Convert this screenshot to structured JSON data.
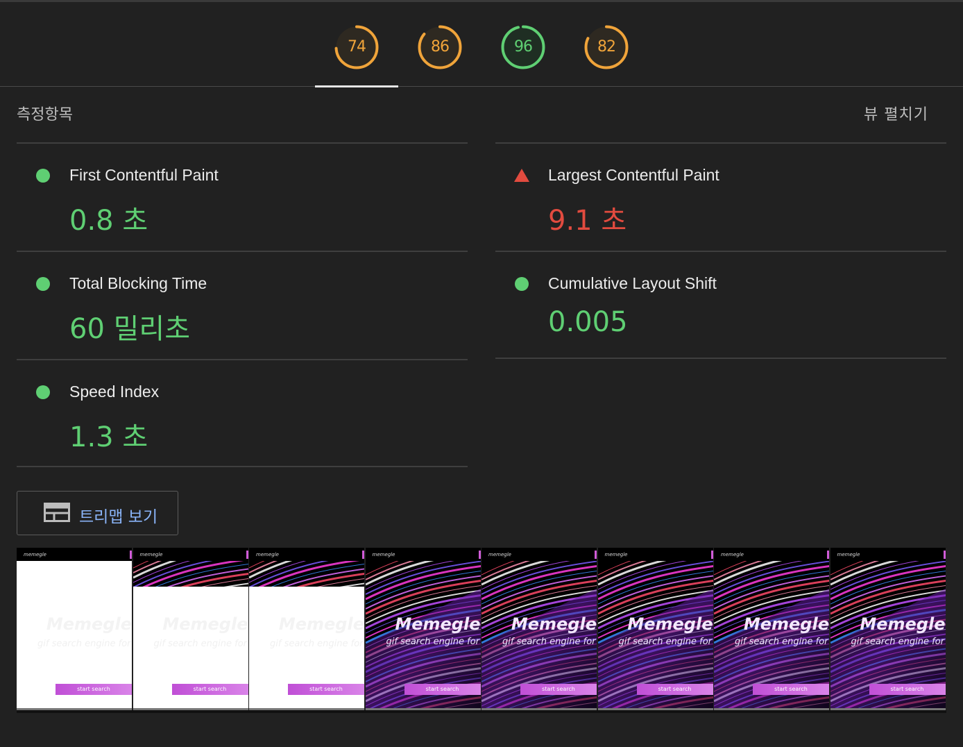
{
  "scores": [
    {
      "value": "74",
      "fraction": 0.74,
      "color": "#f0a43a"
    },
    {
      "value": "86",
      "fraction": 0.86,
      "color": "#f0a43a"
    },
    {
      "value": "96",
      "fraction": 0.96,
      "color": "#5fcf73"
    },
    {
      "value": "82",
      "fraction": 0.82,
      "color": "#f0a43a"
    }
  ],
  "metrics_section": {
    "title": "측정항목",
    "expand_label": "뷰 펼치기"
  },
  "metrics": [
    {
      "name": "First Contentful Paint",
      "value": "0.8 초",
      "status": "good"
    },
    {
      "name": "Largest Contentful Paint",
      "value": "9.1 초",
      "status": "bad"
    },
    {
      "name": "Total Blocking Time",
      "value": "60 밀리초",
      "status": "good"
    },
    {
      "name": "Cumulative Layout Shift",
      "value": "0.005",
      "status": "good"
    },
    {
      "name": "Speed Index",
      "value": "1.3 초",
      "status": "good"
    }
  ],
  "treemap_button": {
    "label": "트리맵 보기",
    "icon": "treemap-icon"
  },
  "filmstrip": {
    "logo": "memegle",
    "title": "Memegle",
    "subtitle": "gif search engine for",
    "button": "start search",
    "frames": [
      "blank",
      "partial",
      "partial",
      "loaded",
      "loaded",
      "loaded",
      "loaded",
      "loaded"
    ]
  },
  "colors": {
    "good": "#5fcf73",
    "average": "#f0a43a",
    "bad": "#e24b3f",
    "link": "#8ab4f8"
  }
}
